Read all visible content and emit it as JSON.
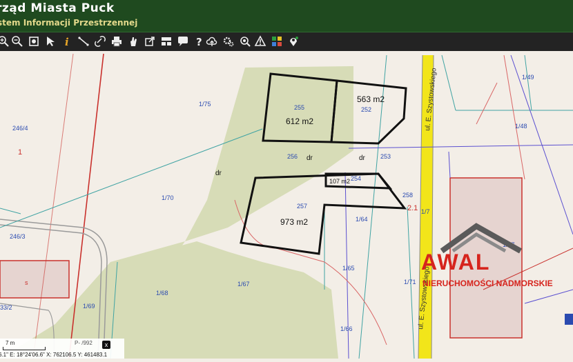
{
  "header": {
    "title": "rząd Miasta Puck",
    "subtitle": "stem Informacji Przestrzennej"
  },
  "toolbar": {
    "tools": [
      {
        "icon": "zoom-in-icon"
      },
      {
        "icon": "zoom-out-icon"
      },
      {
        "icon": "zoom-extent-icon"
      },
      {
        "icon": "pointer-icon"
      },
      {
        "icon": "info-icon"
      },
      {
        "icon": "measure-line-icon"
      },
      {
        "icon": "link-icon"
      },
      {
        "icon": "print-icon"
      },
      {
        "icon": "pan-hand-icon"
      },
      {
        "icon": "export-icon"
      },
      {
        "icon": "layout-icon"
      },
      {
        "icon": "comment-icon"
      },
      {
        "icon": "help-icon"
      },
      {
        "icon": "upload-cloud-icon"
      },
      {
        "icon": "settings-icon"
      },
      {
        "icon": "search-icon"
      },
      {
        "icon": "warning-icon"
      },
      {
        "icon": "layers-grid-icon"
      },
      {
        "icon": "location-icon"
      }
    ]
  },
  "map": {
    "parcels": {
      "p246_4": "246/4",
      "p1": "1",
      "p246_3": "246/3",
      "p33_2": "33/2",
      "p1_75": "1/75",
      "p1_70": "1/70",
      "p1_69": "1/69",
      "p1_68": "1/68",
      "p1_67": "1/67",
      "p1_66": "1/66",
      "p1_65": "1/65",
      "p1_64": "1/64",
      "p255": "255",
      "p252": "252",
      "p256": "256",
      "p253": "253",
      "p254": "254",
      "p257": "257",
      "p258": "258",
      "p1_49": "1/49",
      "p1_48": "1/48",
      "p1_7": "1/7",
      "p1_71": "1/71",
      "p1_77": "1/77",
      "p2_1": "2.1",
      "ps": "s",
      "p3": "3"
    },
    "areas": {
      "a255": "612 m2",
      "a252": "563 m2",
      "a254": "107 m2",
      "a257": "973 m2"
    },
    "landuse": {
      "dr1": "dr",
      "dr2": "dr",
      "dr3": "dr"
    },
    "street_top": "ul. E. Szystowskiego",
    "street_bottom": "ul. E. Szystowskiego"
  },
  "logo": {
    "name": "AWAL",
    "tagline": "NIERUCHOMOŚCI NADMORSKIE"
  },
  "statusbar": {
    "scale_label": "7 m",
    "projection": "P-  /992",
    "close_label": "x",
    "coords": "6.1\" E: 18°24'06.6\"  X: 762106.5  Y: 461483.1"
  },
  "colors": {
    "header_bg": "#1f4a1f",
    "parcel_highlight": "#111111",
    "green_area": "#d6dcb6",
    "road_yellow": "#f2e51a",
    "parcel_boundary_red": "#c9302c",
    "logo_red": "#d6241d"
  }
}
